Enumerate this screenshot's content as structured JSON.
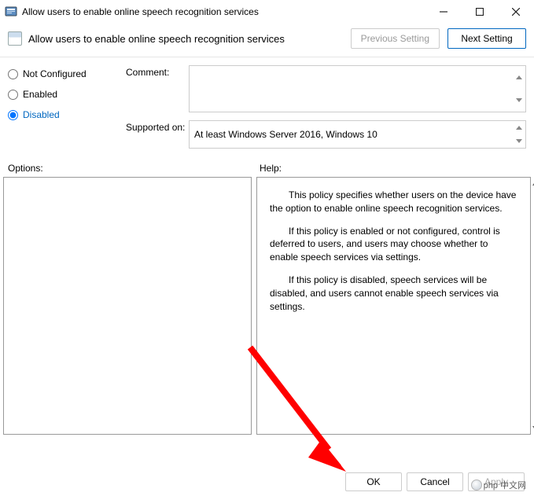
{
  "window": {
    "title": "Allow users to enable online speech recognition services"
  },
  "header": {
    "title": "Allow users to enable online speech recognition services",
    "prev": "Previous Setting",
    "next": "Next Setting"
  },
  "state": {
    "not_configured": "Not Configured",
    "enabled": "Enabled",
    "disabled": "Disabled",
    "selected": "disabled"
  },
  "fields": {
    "comment_label": "Comment:",
    "comment_value": "",
    "supported_label": "Supported on:",
    "supported_value": "At least Windows Server 2016, Windows 10"
  },
  "labels": {
    "options": "Options:",
    "help": "Help:"
  },
  "help": {
    "p1": "This policy specifies whether users on the device have the option to enable online speech recognition services.",
    "p2": "If this policy is enabled or not configured, control is deferred to users, and users may choose whether to enable speech services via settings.",
    "p3": "If this policy is disabled, speech services will be disabled, and users cannot enable speech services via settings."
  },
  "footer": {
    "ok": "OK",
    "cancel": "Cancel",
    "apply": "Apply"
  },
  "watermark": {
    "text": "php 中文网"
  }
}
